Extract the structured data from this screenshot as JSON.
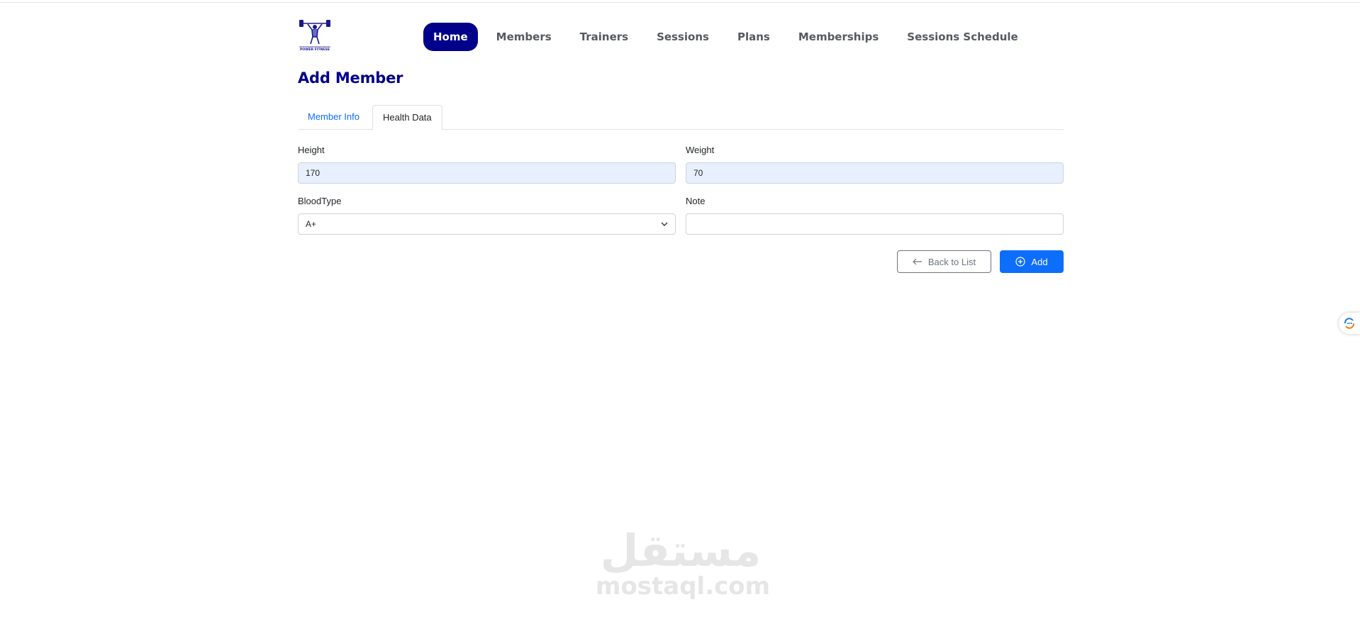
{
  "nav": {
    "logo_text": "POWER FITNESS",
    "items": [
      {
        "label": "Home",
        "active": true
      },
      {
        "label": "Members",
        "active": false
      },
      {
        "label": "Trainers",
        "active": false
      },
      {
        "label": "Sessions",
        "active": false
      },
      {
        "label": "Plans",
        "active": false
      },
      {
        "label": "Memberships",
        "active": false
      },
      {
        "label": "Sessions Schedule",
        "active": false
      }
    ]
  },
  "page": {
    "title": "Add Member"
  },
  "tabs": [
    {
      "label": "Member Info",
      "active": false
    },
    {
      "label": "Health Data",
      "active": true
    }
  ],
  "form": {
    "height": {
      "label": "Height",
      "value": "170"
    },
    "weight": {
      "label": "Weight",
      "value": "70"
    },
    "blood_type": {
      "label": "BloodType",
      "value": "A+"
    },
    "note": {
      "label": "Note",
      "value": ""
    }
  },
  "buttons": {
    "back_label": "Back to List",
    "add_label": "Add"
  },
  "watermark": {
    "arabic": "مستقل",
    "latin": "mostaql.com"
  },
  "colors": {
    "brand": "#00008b",
    "primary": "#0d6efd",
    "autofill": "#e8f0fe"
  }
}
